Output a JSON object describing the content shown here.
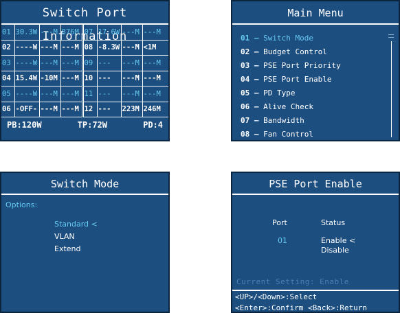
{
  "port_info": {
    "title": "Switch Port Information",
    "rows": [
      {
        "style": "hl",
        "l_num": "01",
        "l_pw": "30.3W",
        "l_a": "---M",
        "l_b": "876M",
        "r_num": "07",
        "r_pw": "17.6W",
        "r_a": "---M",
        "r_b": "---M"
      },
      {
        "style": "on",
        "l_num": "02",
        "l_pw": "----W",
        "l_a": "---M",
        "l_b": "---M",
        "r_num": "08",
        "r_pw": "-8.3W",
        "r_a": "---M",
        "r_b": "<1M"
      },
      {
        "style": "hl",
        "l_num": "03",
        "l_pw": "----W",
        "l_a": "---M",
        "l_b": "---M",
        "r_num": "09",
        "r_pw": "---",
        "r_a": "---M",
        "r_b": "---M"
      },
      {
        "style": "on",
        "l_num": "04",
        "l_pw": "15.4W",
        "l_a": "-10M",
        "l_b": "---M",
        "r_num": "10",
        "r_pw": "---",
        "r_a": "---M",
        "r_b": "---M"
      },
      {
        "style": "hl",
        "l_num": "05",
        "l_pw": "----W",
        "l_a": "---M",
        "l_b": "---M",
        "r_num": "11",
        "r_pw": "---",
        "r_a": "---M",
        "r_b": "---M"
      },
      {
        "style": "on",
        "l_num": "06",
        "l_pw": "-OFF-",
        "l_a": "---M",
        "l_b": "---M",
        "r_num": "12",
        "r_pw": "---",
        "r_a": "223M",
        "r_b": "246M"
      }
    ],
    "footer": {
      "pb": "PB:120W",
      "tp": "TP:72W",
      "pd": "PD:4"
    }
  },
  "main_menu": {
    "title": "Main Menu",
    "items": [
      {
        "num": "01 –",
        "label": "Switch Mode",
        "selected": true
      },
      {
        "num": "02 –",
        "label": "Budget Control"
      },
      {
        "num": "03 –",
        "label": "PSE Port Priority"
      },
      {
        "num": "04 –",
        "label": "PSE Port Enable"
      },
      {
        "num": "05 –",
        "label": "PD Type"
      },
      {
        "num": "06 –",
        "label": "Alive Check"
      },
      {
        "num": "07 –",
        "label": "Bandwidth"
      },
      {
        "num": "08 –",
        "label": "Fan Control"
      }
    ]
  },
  "switch_mode": {
    "title": "Switch Mode",
    "options_label": "Options:",
    "options": [
      "Standard <",
      "VLAN",
      "Extend"
    ]
  },
  "pse_enable": {
    "title": "PSE Port Enable",
    "col_port": "Port",
    "col_status": "Status",
    "port": "01",
    "status_enable": "Enable",
    "status_marker": "<",
    "status_disable": "Disable",
    "current_setting": "Current Setting: Enable",
    "help_line1": "<UP>/<Down>:Select",
    "help_line2": "<Enter>:Confirm <Back>:Return"
  },
  "colors": {
    "panel_bg": "#1d4e80",
    "highlight": "#66c9f2",
    "dim": "#4a7fb5",
    "text": "#ffffff"
  }
}
